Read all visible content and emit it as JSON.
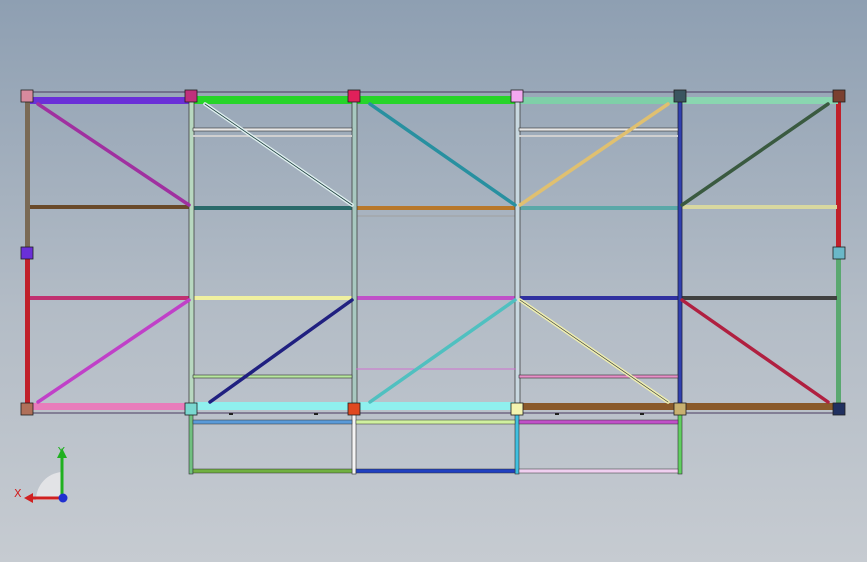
{
  "triad": {
    "x_label": "X",
    "y_label": "Y"
  },
  "colors": {
    "top_chord": [
      "#6a2fd8",
      "#27d42a",
      "#27d42a",
      "#7fcfa8",
      "#8ad6b0"
    ],
    "bottom_chord": [
      "#e87dbb",
      "#8ff0ee",
      "#8ff0ee",
      "#8a5a2a",
      "#8a5a2a"
    ],
    "nodes_top": [
      "#d88a9e",
      "#c0307c",
      "#e0205a",
      "#f3a8f0",
      "#3a5560",
      "#7a4030"
    ],
    "nodes_mid": [
      "#6a2fd8",
      "#6ab8c8"
    ],
    "nodes_bottom": [
      "#b0705a",
      "#7ad8d0",
      "#e04820",
      "#f4f4b0",
      "#c8b070",
      "#203060"
    ]
  }
}
